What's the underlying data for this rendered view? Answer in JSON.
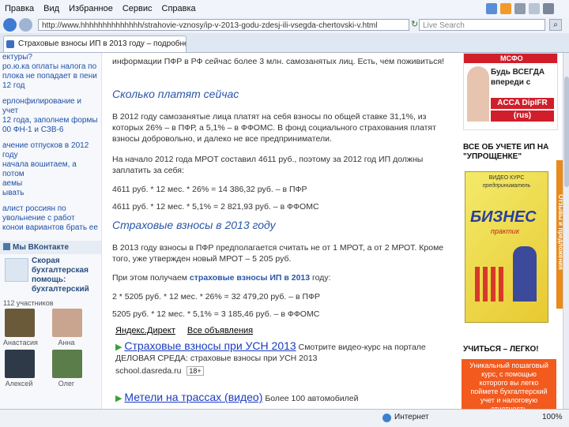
{
  "browser": {
    "menu": [
      "Правка",
      "Вид",
      "Избранное",
      "Сервис",
      "Справка"
    ],
    "address": "http://www.hhhhhhhhhhhhhh/strahovie-vznosy/ip-v-2013-godu-zdesj-ili-vsegda-chertovski-v.html",
    "search_placeholder": "Live Search",
    "tab_title": "Страховые взносы ИП в 2013 году – подробнее",
    "status_internet": "Интернет",
    "zoom": "100%"
  },
  "left": {
    "links": [
      "ектуры?",
      "ро.ю.ка оплаты налога по",
      "плока не попадает в пени",
      "12 год",
      "ерлонфилирование и учет",
      "12 года, заполнем формы",
      "00 ФН-1 и СЗВ-6",
      "ачение отпусков в 2012 году",
      "начала вошитаем, а потом",
      "аемы",
      "ывать",
      "алист россиян по",
      "увольнение с работ",
      "конои вариантов брать ее"
    ],
    "vk_title": "Мы ВКонтакте",
    "vk_group": "Скорая бухгалтерская помощь: бухгалтерский",
    "members": "112 участников",
    "people": [
      "Анастасия",
      "Анна",
      "Алексей",
      "Олег"
    ]
  },
  "main": {
    "intro": "информации ПФР в РФ сейчас более 3 млн. самозанятых лиц. Есть, чем поживиться!",
    "h1": "Сколько платят сейчас",
    "p1": "В 2012 году самозанятые лица платят на себя взносы по общей ставке 31,1%, из которых 26% – в ПФР, а 5,1% – в ФФОМС. В фонд социального страхования платят взносы добровольно, и далеко не все предприниматели.",
    "p2": "На начало 2012 года МРОТ составил 4611 руб., поэтому за 2012 год ИП должны заплатить за себя:",
    "calc1": "4611 руб. * 12 мес. * 26% = 14 386,32 руб. – в ПФР",
    "calc2": "4611 руб. * 12 мес. * 5,1% = 2 821,93 руб. – в ФФОМС",
    "h2": "Страховые взносы в 2013 году",
    "p3": "В 2013 году взносы в ПФР предполагается считать не от 1 МРОТ, а от 2 МРОТ. Кроме того, уже утвержден новый МРОТ – 5 205 руб.",
    "p4_before": "При этом получаем ",
    "p4_link": "страховые взносы ИП в 2013",
    "p4_after": " году:",
    "calc3": "2 * 5205 руб. * 12 мес. * 26% = 32 479,20 руб. – в ПФР",
    "calc4": "5205 руб. * 12 мес. * 5,1% = 3 185,46 руб. – в ФФОМС",
    "direct": "Яндекс.Директ",
    "all_ads": "Все объявления",
    "ad1_title": "Страховые взносы при УСН 2013",
    "ad1_text": "Смотрите видео-курс на портале ДЕЛОВАЯ СРЕДА: страховые взносы при УСН 2013",
    "ad1_url": "school.dasreda.ru",
    "ad1_age": "18+",
    "ad2_title": "Метели на трассах (видео)",
    "ad2_text": "Более 100 автомобилей"
  },
  "right": {
    "banner_logo": "МСФО",
    "banner_line1": "Будь ВСЕГДА",
    "banner_line2": "впереди с",
    "banner_acca": "ACCA DipIFR",
    "banner_rus": "(rus)",
    "section1": "ВСЕ ОБ УЧЕТЕ ИП НА \"УПРОЩЕНКЕ\"",
    "box_top": "ВИДЕО КУРС",
    "box_sub": "предприниматель",
    "box_title": "БИЗНЕС",
    "box_sub2": "практик",
    "side_tab": "Отзывы и предложения",
    "section2": "УЧИТЬСЯ – ЛЕГКО!",
    "learn_text": "Уникальный пошаговый курс, с помощью которого вы легко поймете бухгалтерский учет и налоговую отчетность"
  },
  "colors": {
    "accent": "#2a56a8",
    "banner_red": "#d01f2a",
    "orange": "#e98a1a"
  }
}
